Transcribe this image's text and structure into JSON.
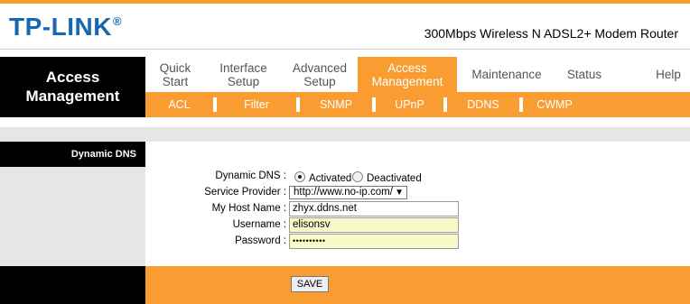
{
  "header": {
    "logo_text": "TP-LINK",
    "logo_mark": "®",
    "model": "300Mbps Wireless N ADSL2+ Modem Router"
  },
  "section_title": "Access Management",
  "nav": {
    "items": [
      {
        "label": "Quick Start",
        "active": false
      },
      {
        "label": "Interface Setup",
        "active": false
      },
      {
        "label": "Advanced Setup",
        "active": false
      },
      {
        "label": "Access Management",
        "active": true
      },
      {
        "label": "Maintenance",
        "active": false
      },
      {
        "label": "Status",
        "active": false
      },
      {
        "label": "Help",
        "active": false
      }
    ]
  },
  "subnav": {
    "items": [
      "ACL",
      "Filter",
      "SNMP",
      "UPnP",
      "DDNS",
      "CWMP"
    ]
  },
  "subsection_title": "Dynamic DNS",
  "form": {
    "ddns_label": "Dynamic DNS :",
    "activated_label": "Activated",
    "deactivated_label": "Deactivated",
    "activated_checked": true,
    "provider_label": "Service Provider :",
    "provider_value": "http://www.no-ip.com/",
    "hostname_label": "My Host Name :",
    "hostname_value": "zhyx.ddns.net",
    "username_label": "Username :",
    "username_value": "elisonsv",
    "password_label": "Password :",
    "password_value": "••••••••••"
  },
  "save_label": "SAVE",
  "colors": {
    "accent": "#f99c32",
    "logo": "#1a66b0",
    "input_highlight": "#fafac8"
  }
}
